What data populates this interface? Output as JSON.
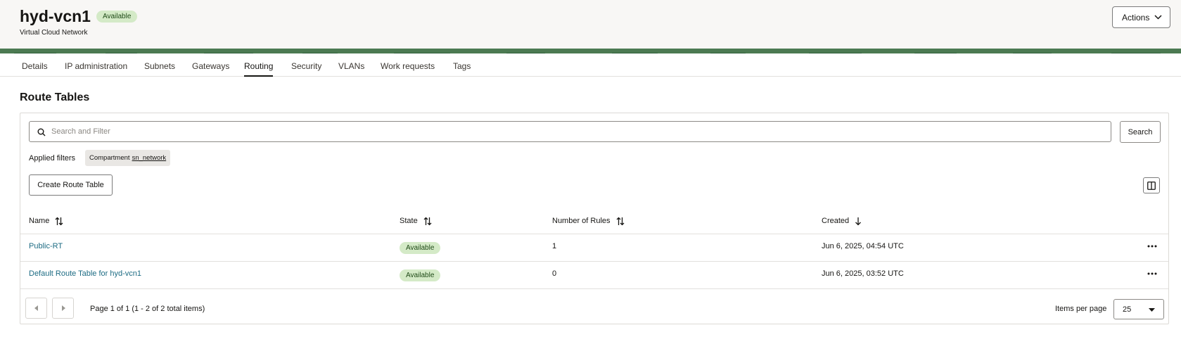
{
  "header": {
    "title": "hyd-vcn1",
    "status": "Available",
    "subtitle": "Virtual Cloud Network",
    "actions_label": "Actions"
  },
  "tabs": [
    {
      "label": "Details"
    },
    {
      "label": "IP administration"
    },
    {
      "label": "Subnets"
    },
    {
      "label": "Gateways"
    },
    {
      "label": "Routing",
      "active": true
    },
    {
      "label": "Security"
    },
    {
      "label": "VLANs"
    },
    {
      "label": "Work requests"
    },
    {
      "label": "Tags"
    }
  ],
  "section": {
    "title": "Route Tables"
  },
  "search": {
    "placeholder": "Search and Filter",
    "button_label": "Search"
  },
  "filters": {
    "label": "Applied filters",
    "chip_key": "Compartment",
    "chip_value": "sn_network"
  },
  "create_button": "Create Route Table",
  "table": {
    "columns": [
      "Name",
      "State",
      "Number of Rules",
      "Created"
    ],
    "rows": [
      {
        "name": "Public-RT",
        "state": "Available",
        "rules": "1",
        "created": "Jun 6, 2025, 04:54 UTC"
      },
      {
        "name": "Default Route Table for hyd-vcn1",
        "state": "Available",
        "rules": "0",
        "created": "Jun 6, 2025, 03:52 UTC"
      }
    ]
  },
  "pagination": {
    "info": "Page 1 of 1 (1 - 2 of 2 total items)",
    "items_per_page_label": "Items per page",
    "items_per_page_value": "25"
  },
  "colors": {
    "accent_text": "#1c6b83",
    "badge_bg": "#d4eac7",
    "header_bg": "#f8f7f5"
  }
}
